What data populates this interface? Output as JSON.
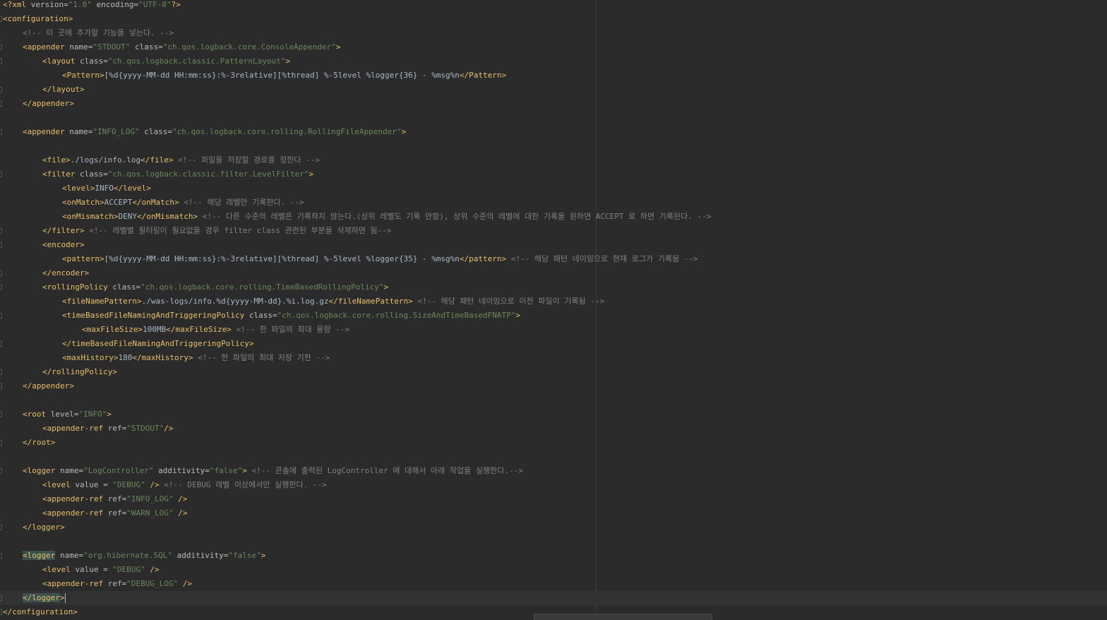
{
  "editor": {
    "lines": [
      {
        "indent": 0,
        "parts": [
          [
            "decl",
            "<?xml"
          ],
          [
            "attr",
            " version="
          ],
          [
            "val",
            "\"1.0\""
          ],
          [
            "attr",
            " encoding="
          ],
          [
            "val",
            "\"UTF-8\""
          ],
          [
            "decl",
            "?>"
          ]
        ]
      },
      {
        "indent": 0,
        "fold": true,
        "parts": [
          [
            "tag",
            "<configuration>"
          ]
        ]
      },
      {
        "indent": 1,
        "parts": [
          [
            "comment",
            "<!-- 이 곳에 추가할 기능을 넣는다. -->"
          ]
        ]
      },
      {
        "indent": 1,
        "fold": true,
        "parts": [
          [
            "tag",
            "<appender"
          ],
          [
            "attr",
            " name="
          ],
          [
            "val",
            "\"STDOUT\""
          ],
          [
            "attr",
            " class="
          ],
          [
            "val",
            "\"ch.qos.logback.core.ConsoleAppender\""
          ],
          [
            "tag",
            ">"
          ]
        ]
      },
      {
        "indent": 2,
        "fold": true,
        "parts": [
          [
            "tag",
            "<layout"
          ],
          [
            "attr",
            " class="
          ],
          [
            "val",
            "\"ch.qos.logback.classic.PatternLayout\""
          ],
          [
            "tag",
            ">"
          ]
        ]
      },
      {
        "indent": 3,
        "parts": [
          [
            "tag",
            "<Pattern>"
          ],
          [
            "text",
            "[%d{yyyy-MM-dd HH:mm:ss}:%-3relative][%thread] %-5level %logger{36} - %msg%n"
          ],
          [
            "tag",
            "</Pattern>"
          ]
        ]
      },
      {
        "indent": 2,
        "fold": true,
        "parts": [
          [
            "tag",
            "</layout>"
          ]
        ]
      },
      {
        "indent": 1,
        "fold": true,
        "parts": [
          [
            "tag",
            "</appender>"
          ]
        ]
      },
      {
        "indent": 0,
        "parts": []
      },
      {
        "indent": 1,
        "fold": true,
        "parts": [
          [
            "tag",
            "<appender"
          ],
          [
            "attr",
            " name="
          ],
          [
            "val",
            "\"INFO_LOG\""
          ],
          [
            "attr",
            " class="
          ],
          [
            "val",
            "\"ch.qos.logback.core.rolling.RollingFileAppender\""
          ],
          [
            "tag",
            ">"
          ]
        ]
      },
      {
        "indent": 0,
        "parts": []
      },
      {
        "indent": 2,
        "parts": [
          [
            "tag",
            "<file>"
          ],
          [
            "text",
            "./logs/info.log"
          ],
          [
            "tag",
            "</file>"
          ],
          [
            "comment",
            " <!-- 파일을 저장할 경로를 정한다 -->"
          ]
        ]
      },
      {
        "indent": 2,
        "fold": true,
        "parts": [
          [
            "tag",
            "<filter"
          ],
          [
            "attr",
            " class="
          ],
          [
            "val",
            "\"ch.qos.logback.classic.filter.LevelFilter\""
          ],
          [
            "tag",
            ">"
          ]
        ]
      },
      {
        "indent": 3,
        "parts": [
          [
            "tag",
            "<level>"
          ],
          [
            "text",
            "INFO"
          ],
          [
            "tag",
            "</level>"
          ]
        ]
      },
      {
        "indent": 3,
        "parts": [
          [
            "tag",
            "<onMatch>"
          ],
          [
            "text",
            "ACCEPT"
          ],
          [
            "tag",
            "</onMatch>"
          ],
          [
            "comment",
            " <!-- 해당 레벨만 기록한다. -->"
          ]
        ]
      },
      {
        "indent": 3,
        "parts": [
          [
            "tag",
            "<onMismatch>"
          ],
          [
            "text",
            "DENY"
          ],
          [
            "tag",
            "</onMismatch>"
          ],
          [
            "comment",
            " <!-- 다른 수준의 레벨은 기록하지 않는다.(상위 레벨도 기록 안함), 상위 수준의 레벨에 대한 기록을 원하면 ACCEPT 로 하면 기록된다. -->"
          ]
        ]
      },
      {
        "indent": 2,
        "fold": true,
        "parts": [
          [
            "tag",
            "</filter>"
          ],
          [
            "comment",
            " <!-- 레벨별 필터링이 필요없을 경우 filter class 관련된 부분을 삭제하면 됨-->"
          ]
        ]
      },
      {
        "indent": 2,
        "fold": true,
        "parts": [
          [
            "tag",
            "<encoder>"
          ]
        ]
      },
      {
        "indent": 3,
        "parts": [
          [
            "tag",
            "<pattern>"
          ],
          [
            "text",
            "[%d{yyyy-MM-dd HH:mm:ss}:%-3relative][%thread] %-5level %logger{35} - %msg%n"
          ],
          [
            "tag",
            "</pattern>"
          ],
          [
            "comment",
            " <!-- 해당 패턴 네이밍으로 현재 로그가 기록됨 -->"
          ]
        ]
      },
      {
        "indent": 2,
        "fold": true,
        "parts": [
          [
            "tag",
            "</encoder>"
          ]
        ]
      },
      {
        "indent": 2,
        "fold": true,
        "parts": [
          [
            "tag",
            "<rollingPolicy"
          ],
          [
            "attr",
            " class="
          ],
          [
            "val",
            "\"ch.qos.logback.core.rolling.TimeBasedRollingPolicy\""
          ],
          [
            "tag",
            ">"
          ]
        ]
      },
      {
        "indent": 3,
        "parts": [
          [
            "tag",
            "<fileNamePattern>"
          ],
          [
            "text",
            "./was-logs/info.%d{yyyy-MM-dd}.%i.log.gz"
          ],
          [
            "tag",
            "</fileNamePattern>"
          ],
          [
            "comment",
            " <!-- 해당 패턴 네이밍으로 이전 파일이 기록됨 -->"
          ]
        ]
      },
      {
        "indent": 3,
        "fold": true,
        "parts": [
          [
            "tag",
            "<timeBasedFileNamingAndTriggeringPolicy"
          ],
          [
            "attr",
            " class="
          ],
          [
            "val",
            "\"ch.qos.logback.core.rolling.SizeAndTimeBasedFNATP\""
          ],
          [
            "tag",
            ">"
          ]
        ]
      },
      {
        "indent": 4,
        "parts": [
          [
            "tag",
            "<maxFileSize>"
          ],
          [
            "text",
            "100MB"
          ],
          [
            "tag",
            "</maxFileSize>"
          ],
          [
            "comment",
            " <!-- 한 파일의 최대 용량 -->"
          ]
        ]
      },
      {
        "indent": 3,
        "fold": true,
        "parts": [
          [
            "tag",
            "</timeBasedFileNamingAndTriggeringPolicy>"
          ]
        ]
      },
      {
        "indent": 3,
        "parts": [
          [
            "tag",
            "<maxHistory>"
          ],
          [
            "text",
            "180"
          ],
          [
            "tag",
            "</maxHistory>"
          ],
          [
            "comment",
            " <!-- 한 파일의 최대 저장 기한 -->"
          ]
        ]
      },
      {
        "indent": 2,
        "fold": true,
        "parts": [
          [
            "tag",
            "</rollingPolicy>"
          ]
        ]
      },
      {
        "indent": 1,
        "fold": true,
        "parts": [
          [
            "tag",
            "</appender>"
          ]
        ]
      },
      {
        "indent": 0,
        "parts": []
      },
      {
        "indent": 1,
        "fold": true,
        "parts": [
          [
            "tag",
            "<root"
          ],
          [
            "attr",
            " level="
          ],
          [
            "val",
            "\"INFO\""
          ],
          [
            "tag",
            ">"
          ]
        ]
      },
      {
        "indent": 2,
        "parts": [
          [
            "tag",
            "<appender-ref"
          ],
          [
            "attr",
            " ref="
          ],
          [
            "val",
            "\"STDOUT\""
          ],
          [
            "tag",
            "/>"
          ]
        ]
      },
      {
        "indent": 1,
        "fold": true,
        "parts": [
          [
            "tag",
            "</root>"
          ]
        ]
      },
      {
        "indent": 0,
        "parts": []
      },
      {
        "indent": 1,
        "fold": true,
        "parts": [
          [
            "tag",
            "<logger"
          ],
          [
            "attr",
            " name="
          ],
          [
            "val",
            "\"LogController\""
          ],
          [
            "attr",
            " additivity="
          ],
          [
            "val",
            "\"false\""
          ],
          [
            "tag",
            ">"
          ],
          [
            "comment",
            " <!-- 콘솔에 출력된 LogController 에 대해서 아래 작업을 실행한다.-->"
          ]
        ]
      },
      {
        "indent": 2,
        "parts": [
          [
            "tag",
            "<level"
          ],
          [
            "attr",
            " value = "
          ],
          [
            "val",
            "\"DEBUG\""
          ],
          [
            "tag",
            " />"
          ],
          [
            "comment",
            " <!-- DEBUG 레벨 이상에서만 실행한다. -->"
          ]
        ]
      },
      {
        "indent": 2,
        "parts": [
          [
            "tag",
            "<appender-ref"
          ],
          [
            "attr",
            " ref="
          ],
          [
            "val",
            "\"INFO_LOG\""
          ],
          [
            "tag",
            " />"
          ]
        ]
      },
      {
        "indent": 2,
        "parts": [
          [
            "tag",
            "<appender-ref"
          ],
          [
            "attr",
            " ref="
          ],
          [
            "val",
            "\"WARN_LOG\""
          ],
          [
            "tag",
            " />"
          ]
        ]
      },
      {
        "indent": 1,
        "fold": true,
        "parts": [
          [
            "tag",
            "</logger>"
          ]
        ]
      },
      {
        "indent": 0,
        "parts": []
      },
      {
        "indent": 1,
        "fold": true,
        "parts": [
          [
            "taghl",
            "<logger"
          ],
          [
            "attr",
            " name="
          ],
          [
            "val",
            "\"org.hibernate.SQL\""
          ],
          [
            "attr",
            " additivity="
          ],
          [
            "val",
            "\"false\""
          ],
          [
            "tag",
            ">"
          ]
        ]
      },
      {
        "indent": 2,
        "parts": [
          [
            "tag",
            "<level"
          ],
          [
            "attr",
            " value = "
          ],
          [
            "val",
            "\"DEBUG\""
          ],
          [
            "tag",
            " />"
          ]
        ]
      },
      {
        "indent": 2,
        "parts": [
          [
            "tag",
            "<appender-ref"
          ],
          [
            "attr",
            " ref="
          ],
          [
            "val",
            "\"DEBUG_LOG\""
          ],
          [
            "tag",
            " />"
          ]
        ]
      },
      {
        "indent": 1,
        "fold": true,
        "current": true,
        "caret": true,
        "parts": [
          [
            "taghl",
            "</logger"
          ],
          [
            "tag",
            ">"
          ]
        ]
      },
      {
        "indent": 0,
        "fold": true,
        "parts": [
          [
            "tag",
            "</configuration>"
          ]
        ]
      }
    ]
  }
}
